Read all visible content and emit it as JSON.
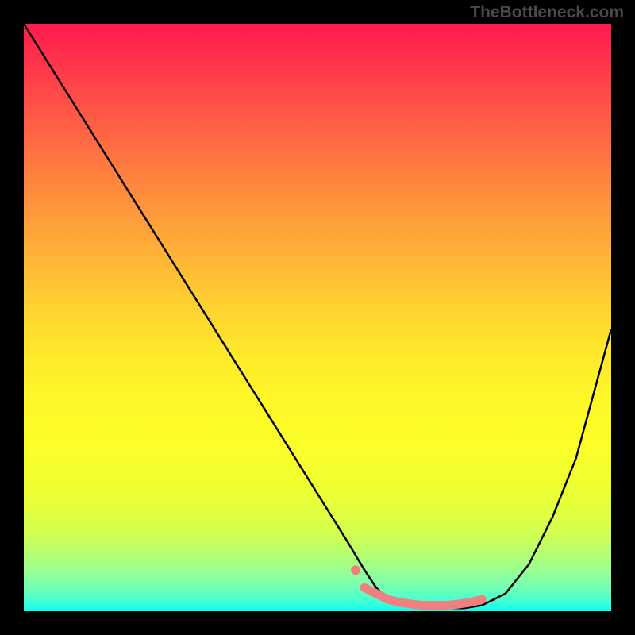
{
  "watermark": "TheBottleneck.com",
  "chart_data": {
    "type": "line",
    "title": "",
    "xlabel": "",
    "ylabel": "",
    "xlim": [
      0,
      100
    ],
    "ylim": [
      0,
      100
    ],
    "grid": false,
    "legend": false,
    "background_gradient": {
      "top": "#ff1a4f",
      "middle": "#ffe82c",
      "bottom": "#0efff2"
    },
    "series": [
      {
        "name": "curve",
        "color": "#000000",
        "x": [
          0,
          5,
          10,
          15,
          20,
          25,
          30,
          35,
          40,
          45,
          50,
          55,
          58,
          60,
          62,
          65,
          70,
          75,
          78,
          82,
          86,
          90,
          94,
          97,
          100
        ],
        "y": [
          100,
          92,
          84,
          76,
          68,
          60,
          52,
          44,
          36,
          28,
          20,
          12,
          7,
          4,
          2,
          1,
          0.5,
          0.5,
          1,
          3,
          8,
          16,
          26,
          37,
          48
        ]
      },
      {
        "name": "highlighted-minimum",
        "type": "scatter",
        "color": "#f08080",
        "x": [
          58,
          60,
          62,
          64,
          66,
          68,
          70,
          72,
          74,
          76,
          78
        ],
        "y": [
          4,
          3,
          2,
          1.5,
          1.2,
          1,
          1,
          1,
          1.2,
          1.5,
          2
        ]
      }
    ],
    "annotations": []
  }
}
